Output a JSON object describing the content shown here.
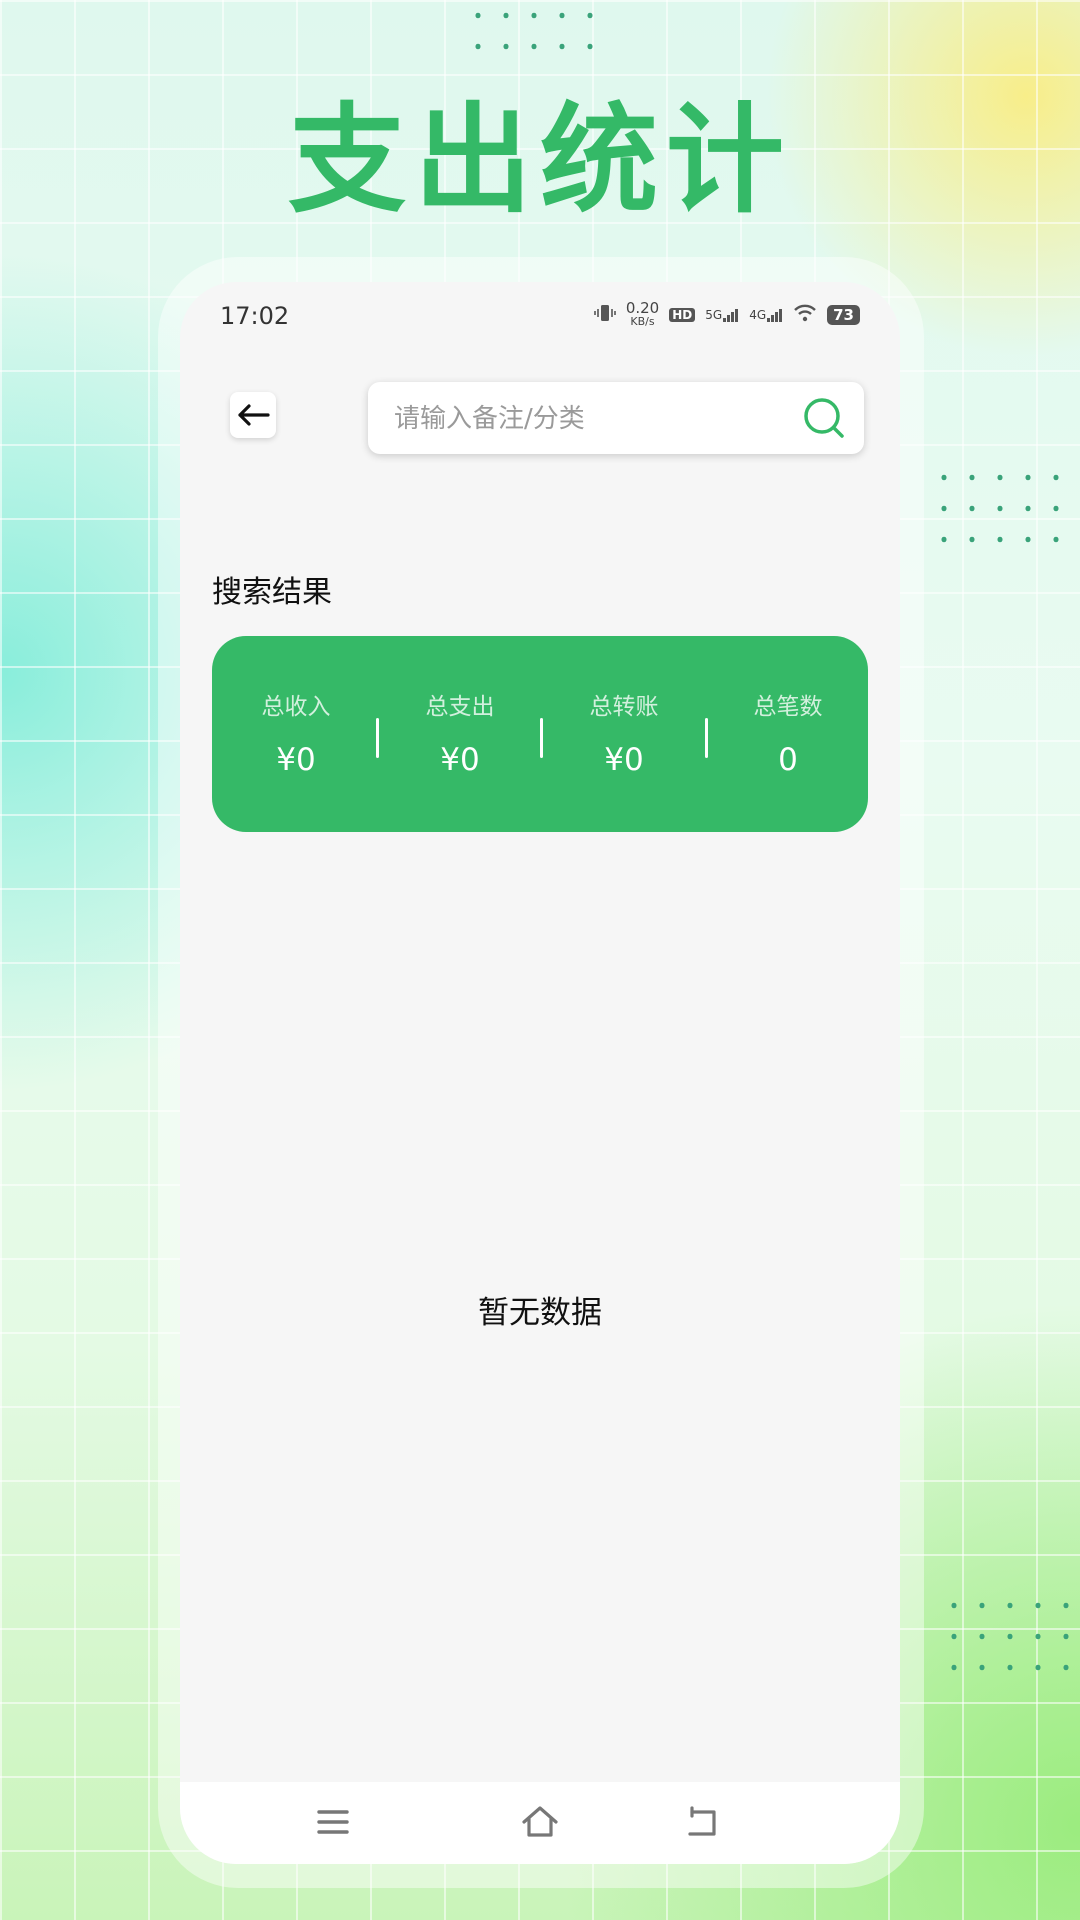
{
  "hero": {
    "title": "支出统计"
  },
  "status_bar": {
    "time": "17:02",
    "net_speed": "0.20",
    "net_speed_unit": "KB/s",
    "hd": "HD",
    "signal_1": "5G",
    "signal_2": "4G",
    "battery": "73",
    "icons": [
      "vibrate-icon",
      "hd-icon",
      "signal-5g-icon",
      "signal-4g-icon",
      "wifi-icon",
      "battery-icon"
    ]
  },
  "header": {
    "back_icon": "arrow-left-icon",
    "search_placeholder": "请输入备注/分类",
    "search_value": "",
    "search_icon": "search-icon"
  },
  "results": {
    "title": "搜索结果",
    "stats": [
      {
        "label": "总收入",
        "value": "¥0"
      },
      {
        "label": "总支出",
        "value": "¥0"
      },
      {
        "label": "总转账",
        "value": "¥0"
      },
      {
        "label": "总笔数",
        "value": "0"
      }
    ],
    "empty_text": "暂无数据"
  },
  "nav": {
    "icons": [
      "menu-icon",
      "home-icon",
      "back-icon"
    ]
  },
  "colors": {
    "accent": "#35b967",
    "background": "#f6f6f6"
  }
}
